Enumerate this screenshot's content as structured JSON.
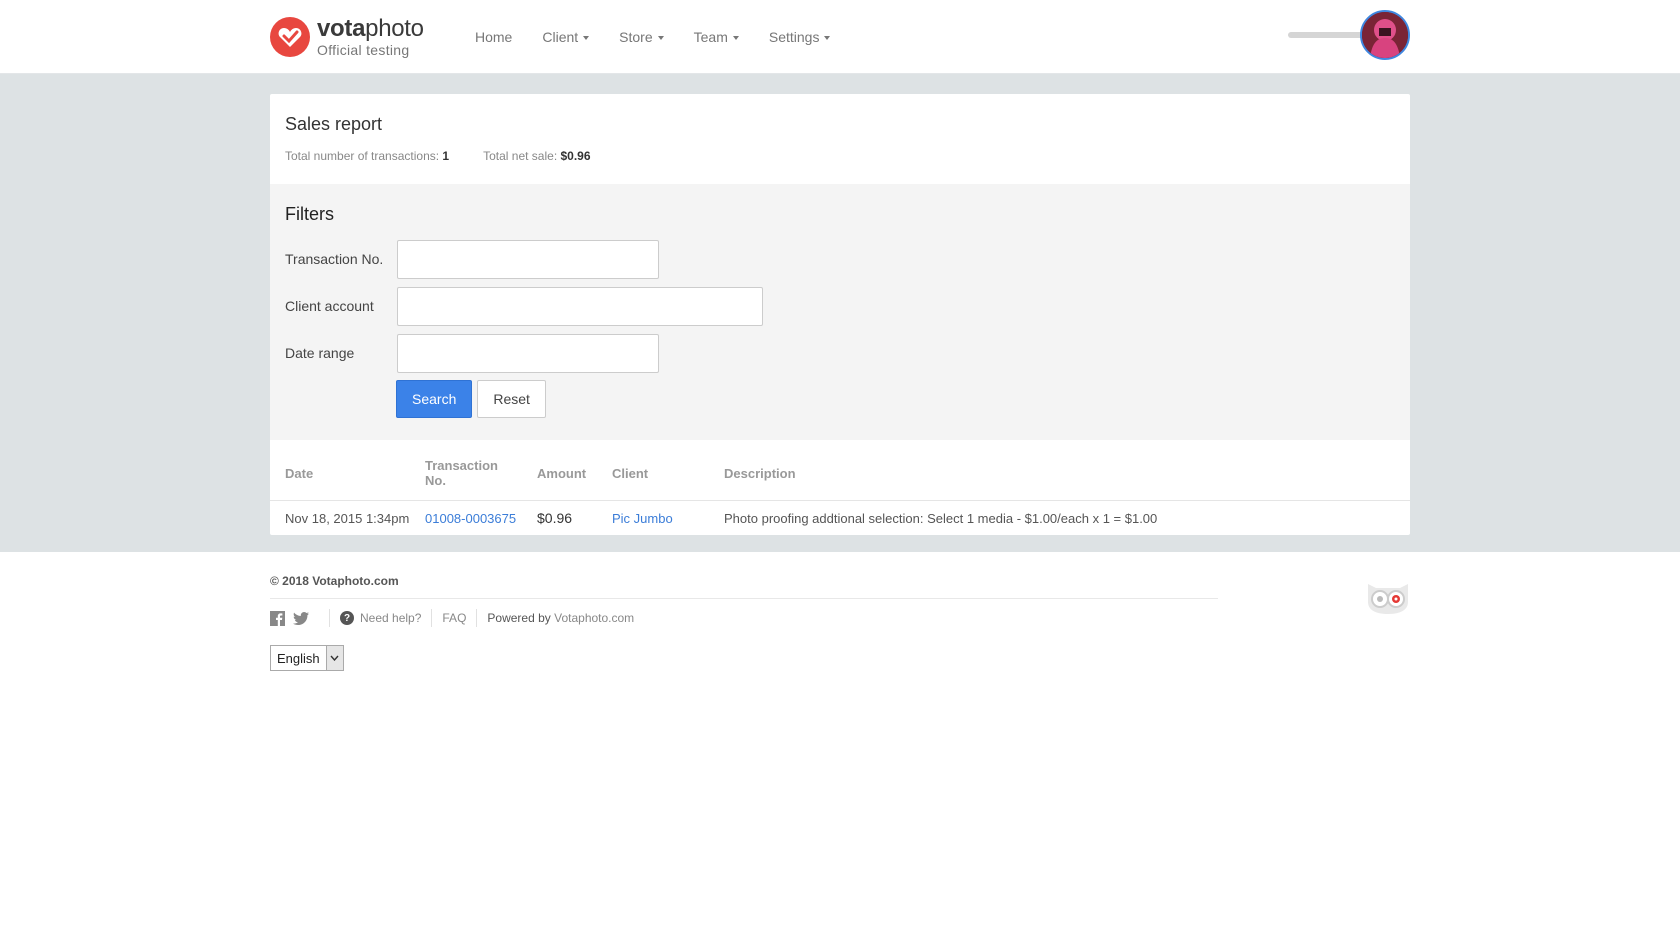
{
  "brand": {
    "name_bold": "vota",
    "name_light": "photo",
    "subtitle": "Official testing"
  },
  "nav": [
    {
      "label": "Home",
      "dropdown": false
    },
    {
      "label": "Client",
      "dropdown": true
    },
    {
      "label": "Store",
      "dropdown": true
    },
    {
      "label": "Team",
      "dropdown": true
    },
    {
      "label": "Settings",
      "dropdown": true
    }
  ],
  "report": {
    "title": "Sales report",
    "transactions_label": "Total number of transactions:",
    "transactions_value": "1",
    "net_sale_label": "Total net sale:",
    "net_sale_value": "$0.96"
  },
  "filters": {
    "title": "Filters",
    "transaction_label": "Transaction No.",
    "transaction_value": "",
    "client_label": "Client account",
    "client_value": "",
    "date_label": "Date range",
    "date_value": "",
    "search_label": "Search",
    "reset_label": "Reset"
  },
  "table": {
    "headers": [
      "Date",
      "Transaction No.",
      "Amount",
      "Client",
      "Description"
    ],
    "rows": [
      {
        "date": "Nov 18, 2015 1:34pm",
        "transaction": "01008-0003675",
        "amount": "$0.96",
        "client": "Pic Jumbo",
        "description": "Photo proofing addtional selection: Select 1 media - $1.00/each x 1 = $1.00"
      }
    ]
  },
  "footer": {
    "copyright": "© 2018 Votaphoto.com",
    "help": "Need help?",
    "faq": "FAQ",
    "powered_prefix": "Powered by",
    "powered_site": "Votaphoto.com",
    "language": "English"
  },
  "colors": {
    "accent": "#3b82e8",
    "brand_red": "#e8473f",
    "link": "#3b7dd8",
    "band": "#dde2e4"
  }
}
